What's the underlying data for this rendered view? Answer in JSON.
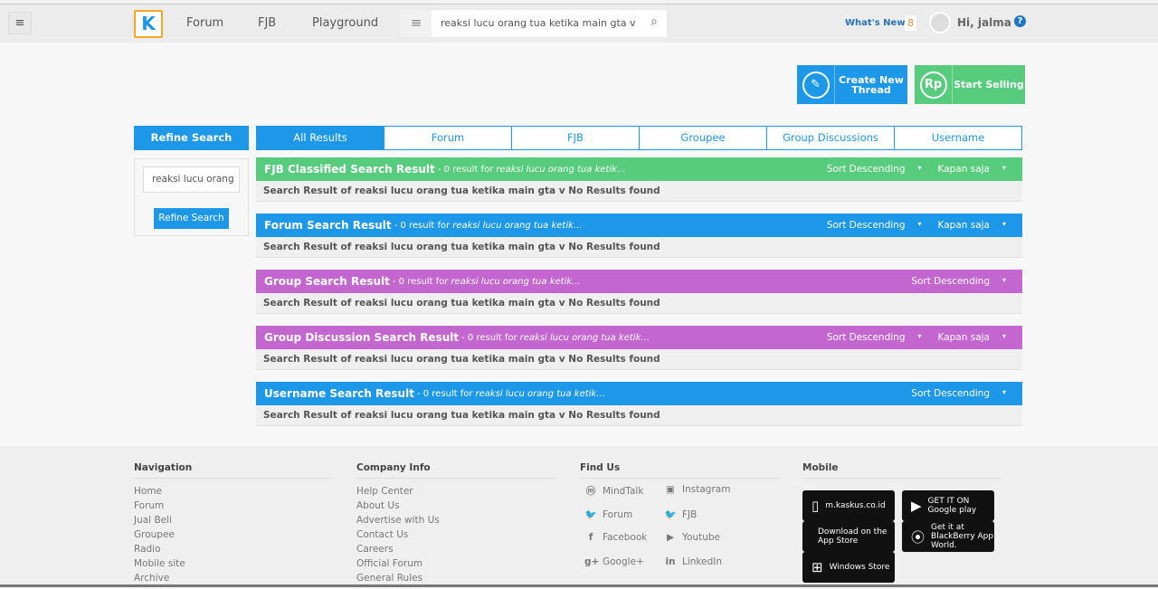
{
  "header": {
    "logo": "K",
    "nav": [
      "Forum",
      "FJB",
      "Playground"
    ],
    "search_value": "reaksi lucu orang tua ketika main gta v",
    "whats_new": "What's New?",
    "notif_count": "8",
    "greeting": "Hi, jalma",
    "help": "?"
  },
  "actions": {
    "create_thread": "Create New Thread",
    "create_icon": "pencil-icon",
    "start_selling": "Start Selling",
    "selling_icon_text": "Rp"
  },
  "colors": {
    "blue": "#1d98e8",
    "green": "#56cc7c",
    "purple": "#c466d0"
  },
  "refine": {
    "title": "Refine Search",
    "input_value": "reaksi lucu orang",
    "button": "Refine Search"
  },
  "tabs": [
    {
      "label": "All Results",
      "active": true
    },
    {
      "label": "Forum"
    },
    {
      "label": "FJB"
    },
    {
      "label": "Groupee"
    },
    {
      "label": "Group Discussions"
    },
    {
      "label": "Username"
    }
  ],
  "sections": [
    {
      "title": "FJB Classified Search Result",
      "count_text": "- 0 result for",
      "query": "reaksi lucu orang tua ketik...",
      "sort": "Sort Descending",
      "time": "Kapan saja",
      "color": "#56cc7c",
      "body": "Search Result of reaksi lucu orang tua ketika main gta v No Results found"
    },
    {
      "title": "Forum Search Result",
      "count_text": "- 0 result for",
      "query": "reaksi lucu orang tua ketik...",
      "sort": "Sort Descending",
      "time": "Kapan saja",
      "color": "#1d98e8",
      "body": "Search Result of reaksi lucu orang tua ketika main gta v No Results found"
    },
    {
      "title": "Group Search Result",
      "count_text": "- 0 result for",
      "query": "reaksi lucu orang tua ketik...",
      "sort": "Sort Descending",
      "color": "#c466d0",
      "body": "Search Result of reaksi lucu orang tua ketika main gta v No Results found"
    },
    {
      "title": "Group Discussion Search Result",
      "count_text": "- 0 result for",
      "query": "reaksi lucu orang tua ketik...",
      "sort": "Sort Descending",
      "time": "Kapan saja",
      "color": "#c466d0",
      "body": "Search Result of reaksi lucu orang tua ketika main gta v No Results found"
    },
    {
      "title": "Username Search Result",
      "count_text": "- 0 result for",
      "query": "reaksi lucu orang tua ketik...",
      "sort": "Sort Descending",
      "color": "#1d98e8",
      "body": "Search Result of reaksi lucu orang tua ketika main gta v No Results found"
    }
  ],
  "footer": {
    "navigation": {
      "title": "Navigation",
      "links": [
        "Home",
        "Forum",
        "Jual Beli",
        "Groupee",
        "Radio",
        "Mobile site",
        "Archive"
      ]
    },
    "company": {
      "title": "Company Info",
      "links": [
        "Help Center",
        "About Us",
        "Advertise with Us",
        "Contact Us",
        "Careers",
        "Official Forum",
        "General Rules"
      ]
    },
    "find_us": {
      "title": "Find Us",
      "links": [
        {
          "label": "MindTalk",
          "icon": "mindtalk-icon"
        },
        {
          "label": "Instagram",
          "icon": "instagram-icon"
        },
        {
          "label": "Forum",
          "icon": "twitter-icon"
        },
        {
          "label": "FJB",
          "icon": "twitter-icon"
        },
        {
          "label": "Facebook",
          "icon": "facebook-icon"
        },
        {
          "label": "Youtube",
          "icon": "youtube-icon"
        },
        {
          "label": "Google+",
          "icon": "googleplus-icon"
        },
        {
          "label": "LinkedIn",
          "icon": "linkedin-icon"
        }
      ]
    },
    "mobile": {
      "title": "Mobile",
      "stores": [
        "m.kaskus.co.id",
        "GET IT ON Google play",
        "Download on the App Store",
        "Get it at BlackBerry App World.",
        "Windows Store"
      ]
    }
  }
}
